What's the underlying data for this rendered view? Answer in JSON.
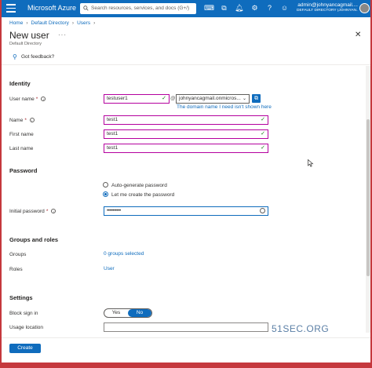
{
  "topbar": {
    "brand": "Microsoft Azure",
    "search_placeholder": "Search resources, services, and docs (G+/)",
    "account_email": "admin@johnyancagmail....",
    "account_directory": "DEFAULT DIRECTORY (JOHNYAN...",
    "icons": [
      "cloud-shell-icon",
      "directory-filter-icon",
      "bell-icon",
      "gear-icon",
      "help-icon",
      "feedback-icon"
    ]
  },
  "breadcrumb": [
    "Home",
    "Default Directory",
    "Users"
  ],
  "header": {
    "title": "New user",
    "subtitle": "Default Directory",
    "more": "···",
    "close": "✕"
  },
  "feedback_label": "Got feedback?",
  "identity": {
    "heading": "Identity",
    "user_name_label": "User name",
    "user_name_value": "testuser1",
    "domain_value": "johnyancagmail.onmicros...",
    "domain_link": "The domain name I need isn't shown here",
    "name_label": "Name",
    "name_value": "test1",
    "first_name_label": "First name",
    "first_name_value": "test1",
    "last_name_label": "Last name",
    "last_name_value": "test1"
  },
  "password": {
    "heading": "Password",
    "option_auto": "Auto-generate password",
    "option_manual": "Let me create the password",
    "selected": "manual",
    "initial_label": "Initial password",
    "initial_value": "••••••••••"
  },
  "groups": {
    "heading": "Groups and roles",
    "groups_label": "Groups",
    "groups_value": "0 groups selected",
    "roles_label": "Roles",
    "roles_value": "User"
  },
  "settings": {
    "heading": "Settings",
    "block_label": "Block sign in",
    "yes": "Yes",
    "no": "No",
    "block_selected": "No",
    "usage_label": "Usage location"
  },
  "footer": {
    "create_label": "Create"
  },
  "watermark": "51SEC.ORG",
  "colors": {
    "accent": "#0f6cbd",
    "valid_border": "#b4009e",
    "check": "#107c10",
    "outer_frame": "#c5383d"
  }
}
